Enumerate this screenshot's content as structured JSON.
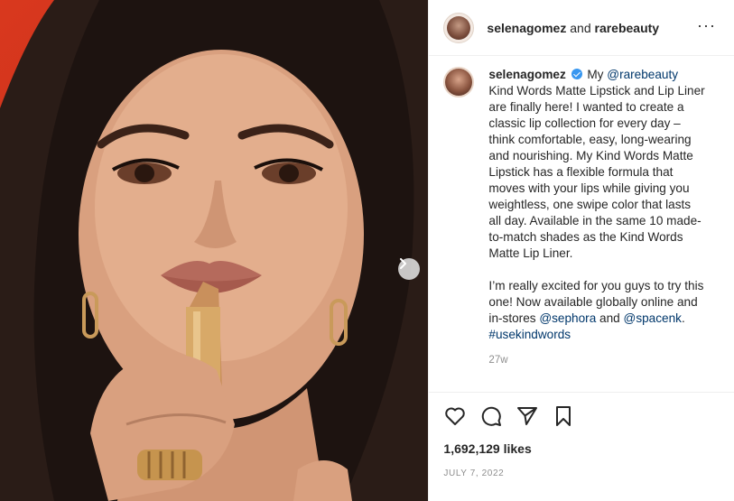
{
  "media": {
    "next_icon": "chevron-right-icon"
  },
  "header": {
    "username_1": "selenagomez",
    "connector": "and",
    "username_2": "rarebeauty",
    "more_icon": "more-icon",
    "more_glyph": "···"
  },
  "caption": {
    "username": "selenagomez",
    "verified_icon": "verified-badge-icon",
    "intro": "My",
    "mention_brand": "@rarebeauty",
    "body_1": "Kind Words Matte Lipstick and Lip Liner are finally here! I wanted to create a classic lip collection for every day – think comfortable, easy, long-wearing and nourishing. My Kind Words Matte Lipstick has a flexible formula that moves with your lips while giving you weightless, one swipe color that lasts all day. Available in the same 10 made-to-match shades as the Kind Words Matte Lip Liner.",
    "body_2": "I’m really excited for you guys to try this one! Now available globally online and in-stores",
    "mention_sephora": "@sephora",
    "and_word": "and",
    "mention_spacenk": "@spacenk",
    "period": ".",
    "hashtag": "#usekindwords",
    "age": "27w"
  },
  "actions": {
    "like_icon": "heart-icon",
    "comment_icon": "comment-icon",
    "share_icon": "share-icon",
    "save_icon": "bookmark-icon",
    "likes": "1,692,129 likes",
    "date": "JULY 7, 2022"
  }
}
